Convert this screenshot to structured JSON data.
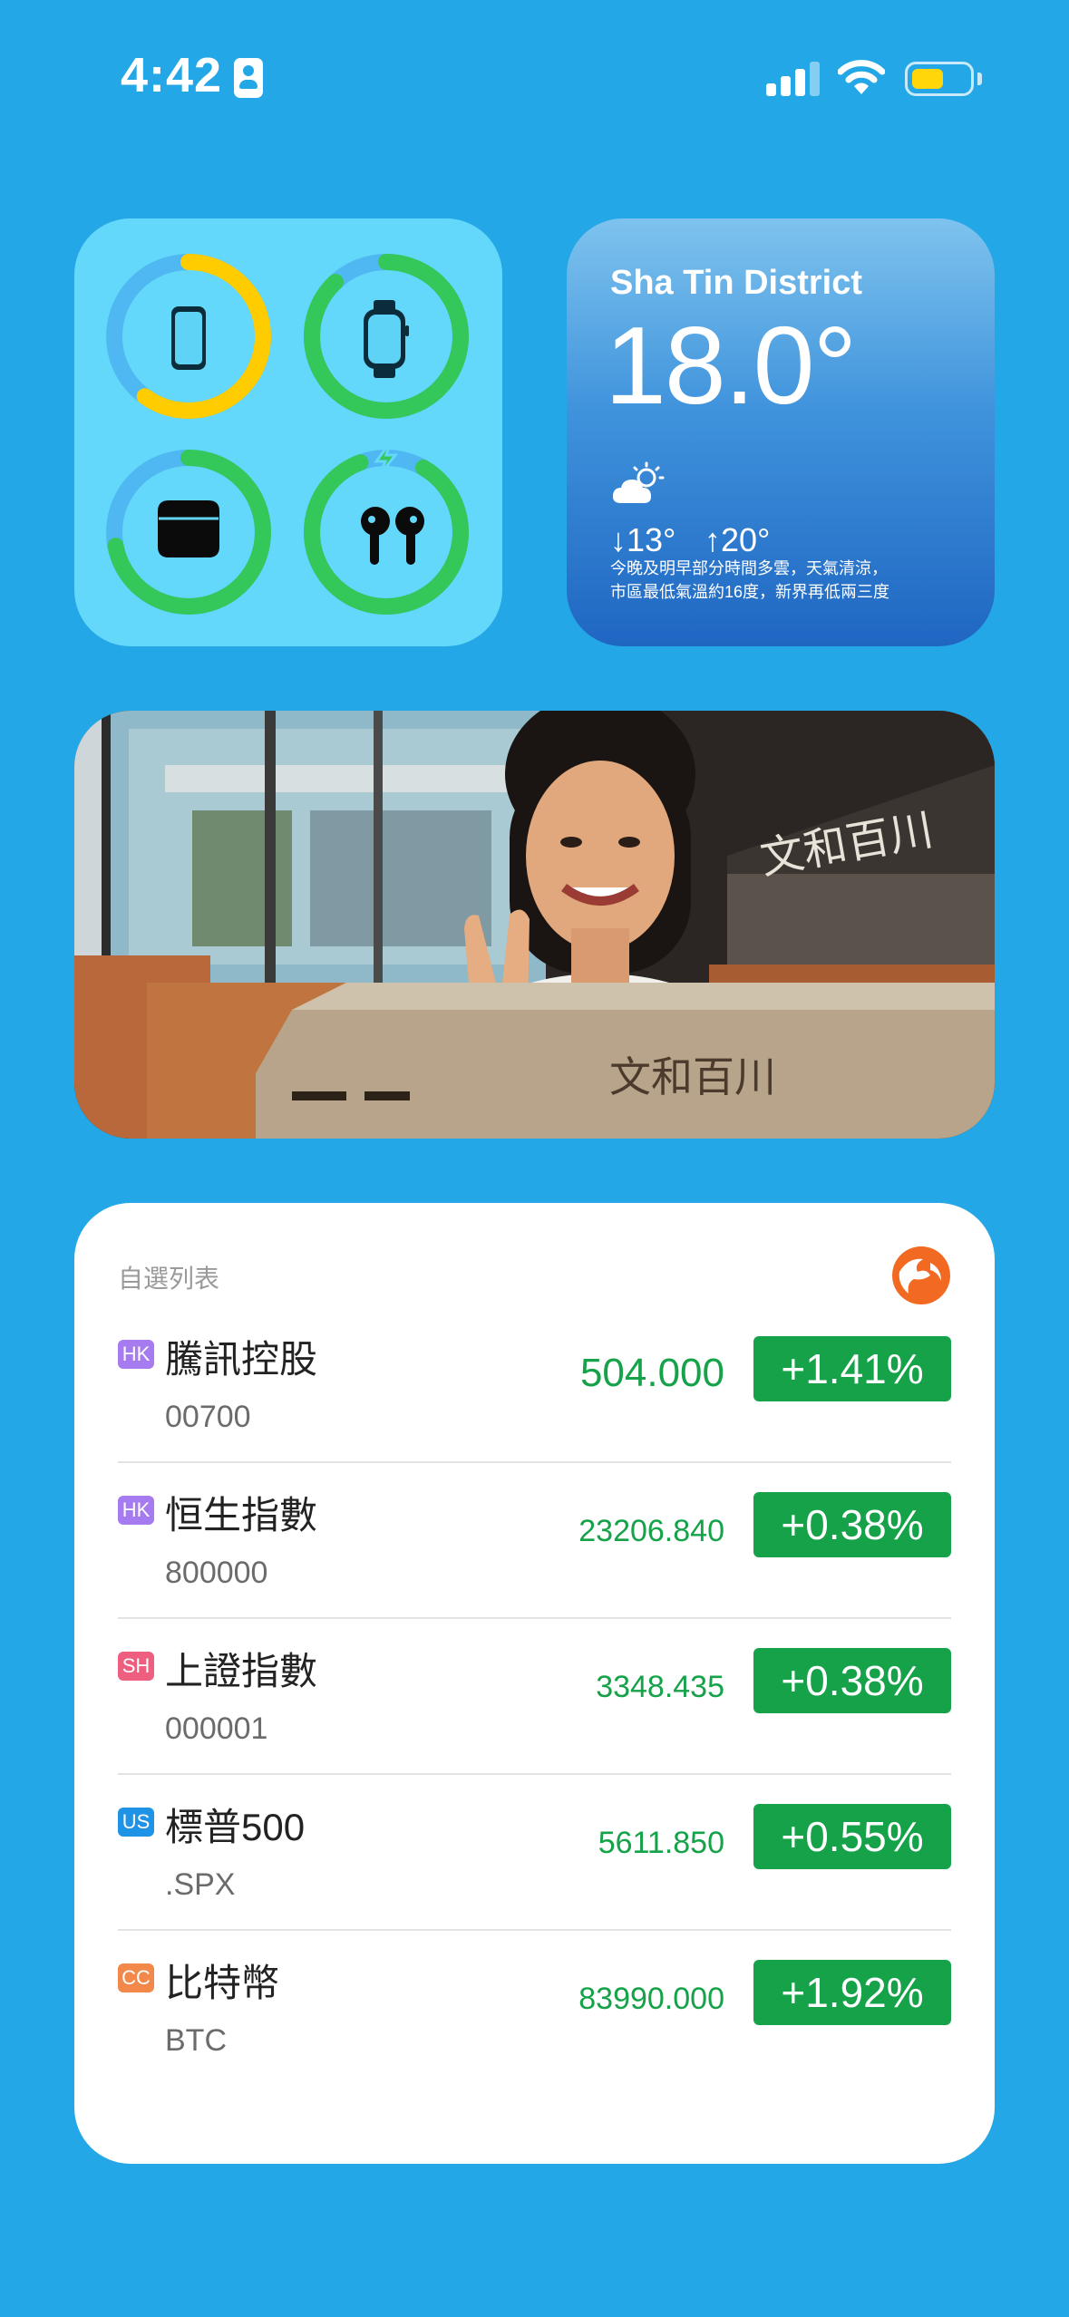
{
  "status_bar": {
    "time": "4:42",
    "battery_level": 0.55,
    "battery_color": "#ffd60a"
  },
  "battery_widget": {
    "devices": [
      {
        "name": "iphone-icon",
        "level": 0.6,
        "ring_color": "#ffcc00",
        "charging": false
      },
      {
        "name": "apple-watch-icon",
        "level": 0.88,
        "ring_color": "#34c759",
        "charging": false
      },
      {
        "name": "airpods-case-icon",
        "level": 0.72,
        "ring_color": "#34c759",
        "charging": false
      },
      {
        "name": "airpods-icon",
        "level": 1.0,
        "ring_color": "#34c759",
        "charging": true
      }
    ]
  },
  "weather": {
    "location": "Sha Tin District",
    "temperature": "18.0°",
    "condition_icon": "partly-cloudy-icon",
    "low": "↓13°",
    "high": "↑20°",
    "description_line1": "今晚及明早部分時間多雲，天氣清涼，",
    "description_line2": "市區最低氣溫約16度，新界再低兩三度"
  },
  "photo": {
    "sign_text": "文和百川"
  },
  "watchlist": {
    "title": "自選列表",
    "stocks": [
      {
        "market": "HK",
        "market_color": "#a77bf0",
        "name": "騰訊控股",
        "code": "00700",
        "price": "504.000",
        "change": "+1.41%"
      },
      {
        "market": "HK",
        "market_color": "#a77bf0",
        "name": "恒生指數",
        "code": "800000",
        "price": "23206.840",
        "change": "+0.38%"
      },
      {
        "market": "SH",
        "market_color": "#ee5f7f",
        "name": "上證指數",
        "code": "000001",
        "price": "3348.435",
        "change": "+0.38%"
      },
      {
        "market": "US",
        "market_color": "#1f93e6",
        "name": "標普500",
        "code": ".SPX",
        "price": "5611.850",
        "change": "+0.55%"
      },
      {
        "market": "CC",
        "market_color": "#f2894a",
        "name": "比特幣",
        "code": "BTC",
        "price": "83990.000",
        "change": "+1.92%"
      }
    ],
    "up_color": "#15a249"
  }
}
